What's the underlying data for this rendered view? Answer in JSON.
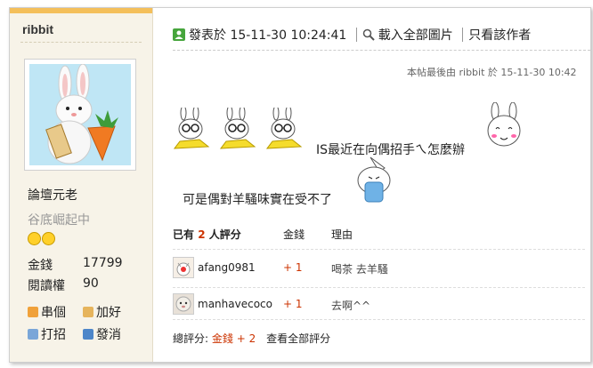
{
  "user": {
    "name": "ribbit",
    "rank": "論壇元老",
    "title": "谷底崛起中",
    "stats": [
      {
        "label": "金錢",
        "value": "17799"
      },
      {
        "label": "閱讀權",
        "value": "90"
      }
    ],
    "actions": [
      {
        "label": "串個",
        "icon": "home-icon"
      },
      {
        "label": "加好",
        "icon": "handshake-icon"
      },
      {
        "label": "打招",
        "icon": "greet-icon"
      },
      {
        "label": "發消",
        "icon": "mail-icon"
      }
    ]
  },
  "post": {
    "posted_label": "發表於",
    "posted_time": "15-11-30 10:24:41",
    "load_images": "載入全部圖片",
    "author_only": "只看該作者",
    "edited_note": "本帖最後由 ribbit 於 15-11-30 10:42",
    "line1": "IS最近在向偶招手ㄟ怎麼辦",
    "line2": "可是偶對羊騷味實在受不了"
  },
  "ratings": {
    "header_prefix": "已有",
    "count": "2",
    "header_suffix": "人評分",
    "col_money": "金錢",
    "col_reason": "理由",
    "rows": [
      {
        "user": "afang0981",
        "money": "+ 1",
        "reason": "喝茶 去羊騷"
      },
      {
        "user": "manhavecoco",
        "money": "+ 1",
        "reason": "去啊^^"
      }
    ],
    "summary_label": "總評分:",
    "summary_item": "金錢",
    "summary_value": "+ 2",
    "view_all": "查看全部評分"
  },
  "colors": {
    "accent_bar": "#f4bf5a",
    "sidebar_bg": "#f7f3e8",
    "rating_red": "#cc3300"
  }
}
